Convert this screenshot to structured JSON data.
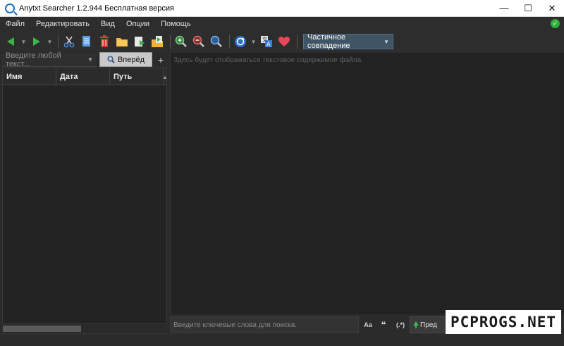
{
  "window": {
    "title": "Anytxt Searcher 1.2.944 Бесплатная версия",
    "minimize_glyph": "—",
    "maximize_glyph": "☐",
    "close_glyph": "✕"
  },
  "menu": {
    "items": [
      "Файл",
      "Редактировать",
      "Вид",
      "Опции",
      "Помощь"
    ]
  },
  "toolbar": {
    "icons": [
      "back-icon",
      "forward-icon",
      "cut-icon",
      "copy-icon",
      "delete-icon",
      "open-folder-icon",
      "export-icon",
      "open-file-icon",
      "zoom-in-icon",
      "zoom-out-icon",
      "search-icon",
      "refresh-icon",
      "translate-icon",
      "favorite-icon"
    ],
    "match_mode": "Частичное совпадение",
    "accent_color": "#3f5465"
  },
  "left_panel": {
    "search_placeholder": "Введите любой текст...",
    "forward_label": "Вперёд",
    "add_glyph": "+",
    "columns": [
      "Имя",
      "Дата",
      "Путь"
    ]
  },
  "content": {
    "placeholder": "Здесь будет отображаться текстовое содержимое файла."
  },
  "bottom": {
    "keyword_placeholder": "Введите ключевые слова для поиска.",
    "case_label": "Aa",
    "quote_label": "❝",
    "regex_label": "(.*)",
    "preview_label": "Пред"
  },
  "watermark": {
    "text": "PCPROGS.NET"
  }
}
